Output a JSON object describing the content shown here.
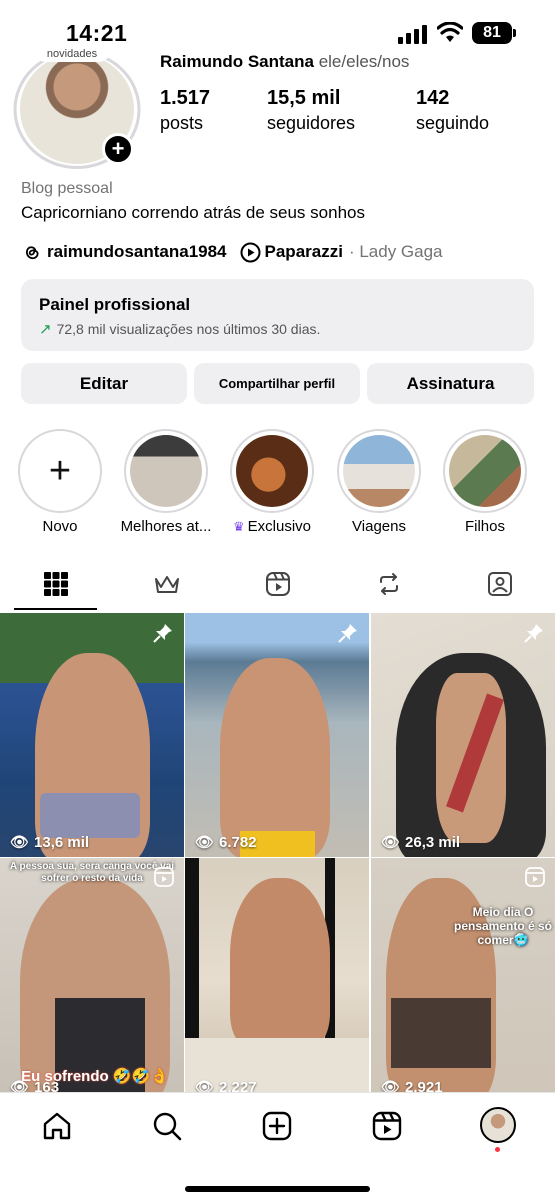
{
  "status_bar": {
    "time": "14:21",
    "battery": "81"
  },
  "profile": {
    "name": "Raimundo Santana",
    "pronouns": "ele/eles/nos",
    "avatar_note": "novidades",
    "stats": [
      {
        "value": "1.517",
        "label": "posts"
      },
      {
        "value": "15,5 mil",
        "label": "seguidores"
      },
      {
        "value": "142",
        "label": "seguindo"
      }
    ],
    "category": "Blog pessoal",
    "bio": "Capricorniano correndo atrás de seus sonhos",
    "threads_handle": "raimundosantana1984",
    "song": "Paparazzi",
    "artist": "· Lady Gaga"
  },
  "pro_panel": {
    "title": "Painel profissional",
    "subtitle": "72,8 mil visualizações nos últimos 30 dias."
  },
  "buttons": {
    "edit": "Editar",
    "share": "Compartilhar perfil",
    "subscription": "Assinatura"
  },
  "highlights": [
    {
      "label": "Novo"
    },
    {
      "label": "Melhores at..."
    },
    {
      "label": "Exclusivo"
    },
    {
      "label": "Viagens"
    },
    {
      "label": "Filhos"
    }
  ],
  "tabs": [
    "grid-icon",
    "crown-icon",
    "reels-icon",
    "repost-icon",
    "tagged-icon"
  ],
  "posts": [
    {
      "views": "13,6 mil",
      "pinned": true
    },
    {
      "views": "6.782",
      "pinned": true
    },
    {
      "views": "26,3 mil",
      "pinned": true
    },
    {
      "views": "163",
      "pinned": false,
      "caption_top": "A pessoa sua, sera canga você vai sofrer o resto da vida",
      "caption_bottom": "Eu sofrendo 🤣🤣👌"
    },
    {
      "views": "2.227",
      "pinned": false
    },
    {
      "views": "2.921",
      "pinned": false,
      "caption_top": "Meio dia O pensamento é só comer🥶"
    }
  ],
  "bottom_nav": [
    "home-icon",
    "search-icon",
    "create-icon",
    "reels-icon",
    "profile-avatar"
  ],
  "colors": {
    "accent_green": "#1e9e55",
    "crown_purple": "#7b3ff2",
    "notification_dot": "#ff3040"
  }
}
